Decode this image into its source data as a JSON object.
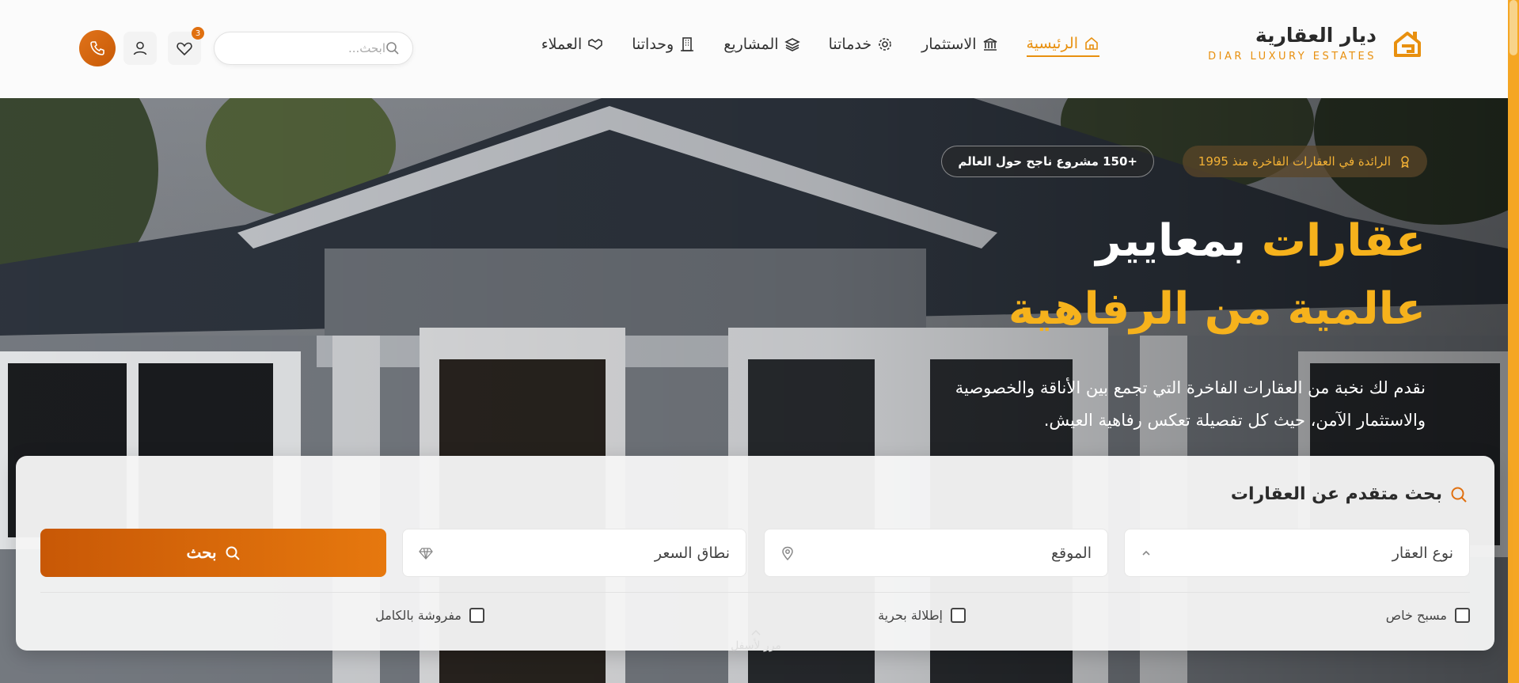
{
  "brand": {
    "name": "ديار العقارية",
    "tagline": "DIAR LUXURY ESTATES",
    "accent": "#e8900f"
  },
  "nav": {
    "items": [
      {
        "label": "الرئيسية",
        "icon": "home-icon",
        "active": true
      },
      {
        "label": "الاستثمار",
        "icon": "bank-icon",
        "active": false
      },
      {
        "label": "خدماتنا",
        "icon": "gear-icon",
        "active": false
      },
      {
        "label": "المشاريع",
        "icon": "layers-icon",
        "active": false
      },
      {
        "label": "وحداتنا",
        "icon": "building-icon",
        "active": false
      },
      {
        "label": "العملاء",
        "icon": "handshake-icon",
        "active": false
      }
    ]
  },
  "header": {
    "search_placeholder": "ابحث...",
    "favorites_count": "3"
  },
  "hero": {
    "badge_gold": "الرائدة في العقارات الفاخرة منذ 1995",
    "badge_dark": "+150 مشروع ناجح حول العالم",
    "title_line1_gold": "عقارات",
    "title_line1_white": "بمعايير",
    "title_line2": "عالمية من الرفاهية",
    "description": "نقدم لك نخبة من العقارات الفاخرة التي تجمع بين الأناقة والخصوصية والاستثمار الآمن، حيث كل تفصيلة تعكس رفاهية العيش."
  },
  "search_panel": {
    "title": "بحث متقدم عن العقارات",
    "field_type": "نوع العقار",
    "field_location": "الموقع",
    "field_price": "نطاق السعر",
    "button": "بحث",
    "options": [
      "مسبح خاص",
      "إطلالة بحرية",
      "مفروشة بالكامل"
    ]
  },
  "scroll_hint": "مرر لأسفل",
  "colors": {
    "accent": "#e8900f",
    "gold": "#f6b21c",
    "button": "#d86a0a"
  }
}
